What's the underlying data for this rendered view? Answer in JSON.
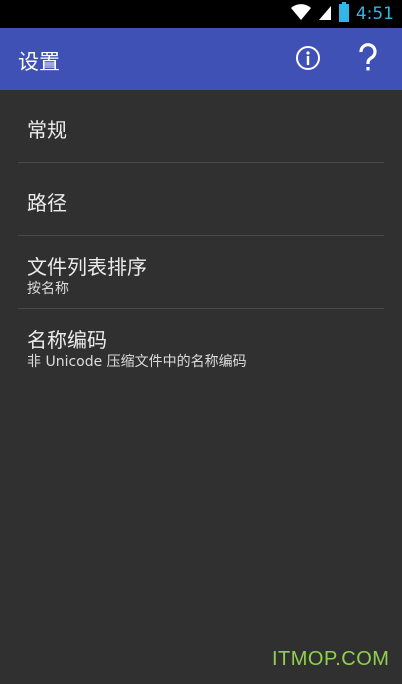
{
  "status_bar": {
    "time": "4:51",
    "icons": [
      "wifi-icon",
      "signal-icon",
      "battery-icon"
    ]
  },
  "app_bar": {
    "title": "设置",
    "actions": [
      "info-icon",
      "help-icon"
    ],
    "color": "#3f51b5"
  },
  "preferences": [
    {
      "title": "常规",
      "summary": ""
    },
    {
      "title": "路径",
      "summary": ""
    },
    {
      "title": "文件列表排序",
      "summary": "按名称"
    },
    {
      "title": "名称编码",
      "summary": "非 Unicode 压缩文件中的名称编码"
    }
  ],
  "watermark": "ITMOP.COM"
}
